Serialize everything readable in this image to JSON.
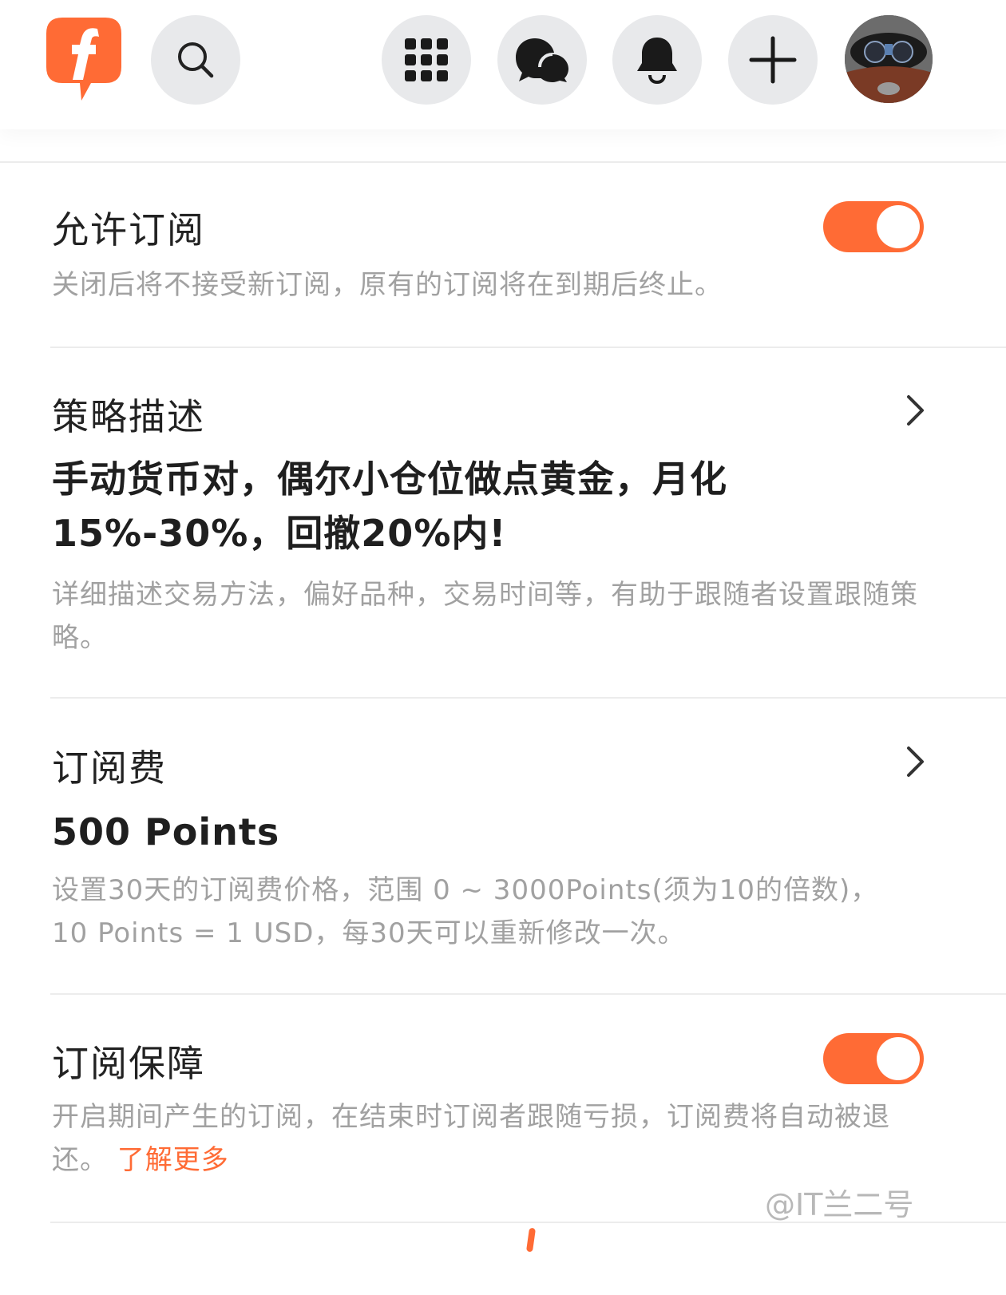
{
  "colors": {
    "accent": "#ff6b35",
    "icon_bg": "#e8e9eb",
    "hint_text": "#a1a1a1"
  },
  "header": {
    "logo_icon": "f-speech-bubble-logo",
    "icons": [
      "search-icon",
      "apps-grid-icon",
      "chat-bubbles-icon",
      "bell-icon",
      "plus-icon"
    ],
    "avatar": "user-avatar"
  },
  "allow_subscription": {
    "title": "允许订阅",
    "hint": "关闭后将不接受新订阅，原有的订阅将在到期后终止。",
    "enabled": true
  },
  "strategy": {
    "title": "策略描述",
    "value": "手动货币对，偶尔小仓位做点黄金，月化15%-30%，回撤20%内!",
    "hint": "详细描述交易方法，偏好品种，交易时间等，有助于跟随者设置跟随策略。"
  },
  "fee": {
    "title": "订阅费",
    "value": "500 Points",
    "hint_line1": "设置30天的订阅费价格，范围 0 ~ 3000Points(须为10的倍数)，",
    "hint_line2": "10 Points = 1 USD，每30天可以重新修改一次。"
  },
  "guarantee": {
    "title": "订阅保障",
    "hint": "开启期间产生的订阅，在结束时订阅者跟随亏损，订阅费将自动被退还。",
    "link": "了解更多",
    "enabled": true
  },
  "watermark": "@IT兰二号"
}
